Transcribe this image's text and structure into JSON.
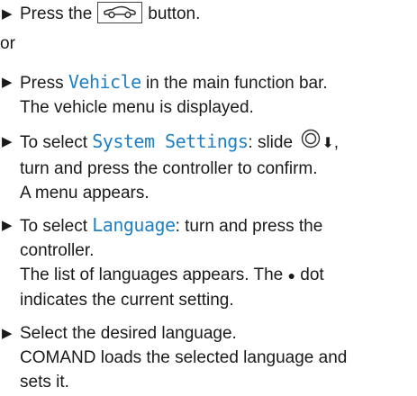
{
  "steps": [
    {
      "text_before_icon": "Press the",
      "text_after_icon": "button."
    },
    {
      "or": "or"
    },
    {
      "pre": "Press",
      "ui": "Vehicle",
      "post": "in the main function bar.",
      "line2": "The vehicle menu is displayed."
    },
    {
      "pre": "To select",
      "ui": "System Settings",
      "post": ": slide",
      "line2": "turn and press the controller to confirm.",
      "line3": "A menu appears."
    },
    {
      "pre": "To select",
      "ui": "Language",
      "post": ": turn and press the",
      "line2": "controller.",
      "line3": "The list of languages appears. The",
      "line3_post": "dot",
      "line4": "indicates the current setting."
    },
    {
      "line1": "Select the desired language.",
      "line2": "COMAND loads the selected language and",
      "line3": "sets it."
    }
  ],
  "colors": {
    "ui_highlight": "#1f7fc4",
    "text": "#1a1a1a"
  },
  "icons": {
    "bullet": "triangle-right",
    "car_button": "vehicle-icon",
    "controller": "controller-ring-icon",
    "slide_arrow": "down-arrow-icon",
    "dot": "filled-dot"
  }
}
